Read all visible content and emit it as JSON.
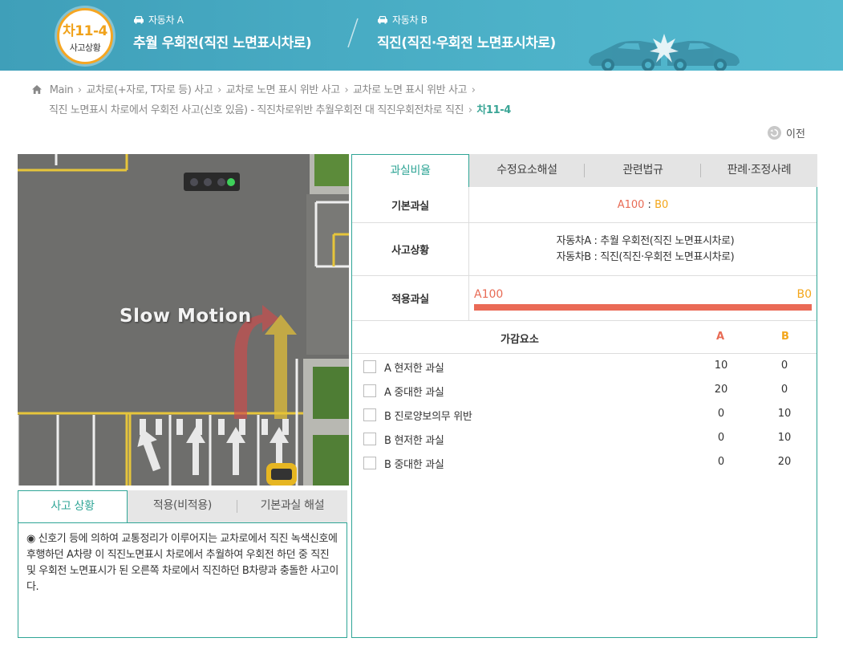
{
  "header": {
    "badge_code": "차11-4",
    "badge_sub": "사고상황",
    "car_a_tag": "자동차 A",
    "car_a_title": "추월 우회전(직진 노면표시차로)",
    "car_b_tag": "자동차 B",
    "car_b_title": "직진(직진·우회전 노면표시차로)"
  },
  "breadcrumb": {
    "home": "Main",
    "items": [
      "교차로(+자로, T자로 등) 사고",
      "교차로 노면 표시 위반 사고",
      "교차로 노면 표시 위반 사고"
    ],
    "line2": "직진 노면표시 차로에서 우회전 사고(신호 있음) - 직진차로위반 추월우회전 대 직진우회전차로 직진",
    "current": "차11-4"
  },
  "prev_label": "이전",
  "video": {
    "overlay_text": "Slow Motion"
  },
  "bottom_tabs": [
    "사고 상황",
    "적용(비적용)",
    "기본과실 해설"
  ],
  "bottom_panel_text": "◉ 신호기 등에 의하여 교통정리가 이루어지는 교차로에서 직진 녹색신호에 후행하던 A차량 이 직진노면표시 차로에서 추월하여 우회전 하던 중 직진 및 우회전 노면표시가 된 오른쪽 차로에서 직진하던 B차량과 충돌한 사고이다.",
  "right_tabs": [
    "과실비율",
    "수정요소해설",
    "관련법규",
    "판례·조정사례"
  ],
  "fault": {
    "basic_label": "기본과실",
    "basic_a": "A100",
    "basic_sep": " : ",
    "basic_b": "B0",
    "situation_label": "사고상황",
    "situation_a": "자동차A : 추월 우회전(직진 노면표시차로)",
    "situation_b": "자동차B : 직진(직진·우회전 노면표시차로)",
    "applied_label": "적용과실",
    "applied_a": "A100",
    "applied_b": "B0",
    "applied_a_fraction": 1.0
  },
  "adjust": {
    "header_label": "가감요소",
    "header_a": "A",
    "header_b": "B",
    "rows": [
      {
        "label": "A 현저한 과실",
        "a": "10",
        "b": "0"
      },
      {
        "label": "A 중대한 과실",
        "a": "20",
        "b": "0"
      },
      {
        "label": "B 진로양보의무 위반",
        "a": "0",
        "b": "10"
      },
      {
        "label": "B 현저한 과실",
        "a": "0",
        "b": "10"
      },
      {
        "label": "B 중대한 과실",
        "a": "0",
        "b": "20"
      }
    ]
  },
  "colors": {
    "header_bg": "#4cb1c8",
    "accent_green": "#2fa596",
    "fault_a": "#e86b55",
    "fault_b": "#f3a61a"
  }
}
